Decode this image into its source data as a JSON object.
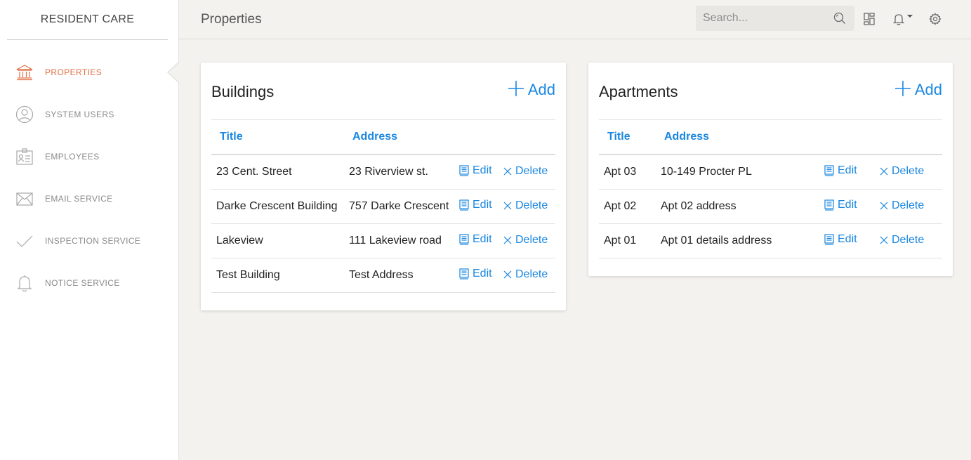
{
  "app": {
    "brand": "RESIDENT CARE",
    "accent": "#e06f45",
    "link_color": "#1a87e0"
  },
  "sidebar": {
    "items": [
      {
        "label": "PROPERTIES",
        "icon": "bank-icon",
        "active": true
      },
      {
        "label": "SYSTEM USERS",
        "icon": "user-circle-icon"
      },
      {
        "label": "EMPLOYEES",
        "icon": "id-card-icon"
      },
      {
        "label": "EMAIL SERVICE",
        "icon": "envelope-icon"
      },
      {
        "label": "INSPECTION SERVICE",
        "icon": "checkmark-icon"
      },
      {
        "label": "NOTICE SERVICE",
        "icon": "bell-icon"
      }
    ]
  },
  "header": {
    "title": "Properties",
    "search": {
      "placeholder": "Search...",
      "value": ""
    },
    "icons": [
      "search-icon",
      "dashboard-icon",
      "notification-bell-icon",
      "settings-icon"
    ]
  },
  "buildings": {
    "title": "Buildings",
    "add_label": "Add",
    "columns": [
      "Title",
      "Address"
    ],
    "rows": [
      {
        "title": "23 Cent. Street",
        "address": "23 Riverview st."
      },
      {
        "title": "Darke Crescent Building",
        "address": "757 Darke Crescent"
      },
      {
        "title": "Lakeview",
        "address": "111 Lakeview road"
      },
      {
        "title": "Test Building",
        "address": "Test Address"
      }
    ],
    "edit_label": "Edit",
    "delete_label": "Delete"
  },
  "apartments": {
    "title": "Apartments",
    "add_label": "Add",
    "columns": [
      "Title",
      "Address"
    ],
    "rows": [
      {
        "title": "Apt 03",
        "address": "10-149 Procter PL"
      },
      {
        "title": "Apt 02",
        "address": "Apt 02 address"
      },
      {
        "title": "Apt 01",
        "address": "Apt 01 details address"
      }
    ],
    "edit_label": "Edit",
    "delete_label": "Delete"
  }
}
